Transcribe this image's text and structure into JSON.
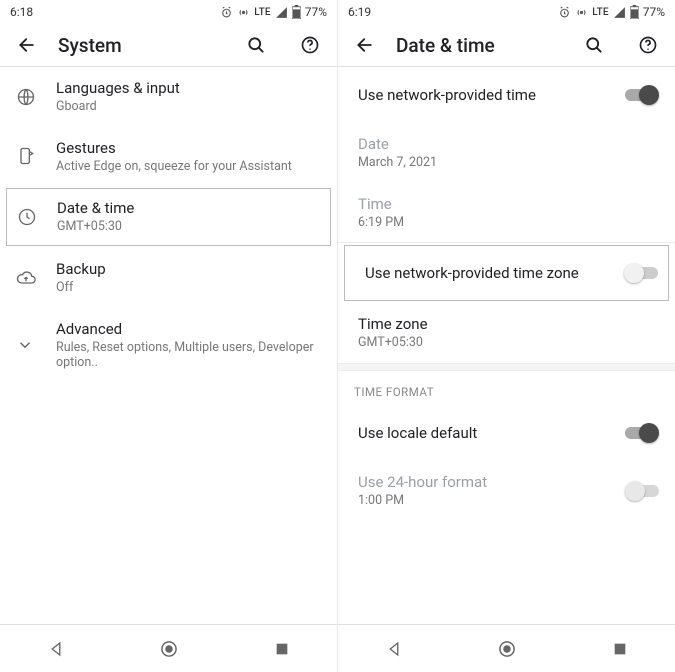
{
  "left": {
    "status": {
      "time": "6:18",
      "lte": "LTE",
      "battery": "77%"
    },
    "appbar": {
      "title": "System"
    },
    "rows": {
      "languages": {
        "label": "Languages & input",
        "sub": "Gboard"
      },
      "gestures": {
        "label": "Gestures",
        "sub": "Active Edge on, squeeze for your Assistant"
      },
      "datetime": {
        "label": "Date & time",
        "sub": "GMT+05:30"
      },
      "backup": {
        "label": "Backup",
        "sub": "Off"
      },
      "advanced": {
        "label": "Advanced",
        "sub": "Rules, Reset options, Multiple users, Developer option.."
      }
    }
  },
  "right": {
    "status": {
      "time": "6:19",
      "lte": "LTE",
      "battery": "77%"
    },
    "appbar": {
      "title": "Date & time"
    },
    "rows": {
      "net_time": {
        "label": "Use network-provided time"
      },
      "date": {
        "label": "Date",
        "sub": "March 7, 2021"
      },
      "time": {
        "label": "Time",
        "sub": "6:19 PM"
      },
      "net_tz": {
        "label": "Use network-provided time zone"
      },
      "tz": {
        "label": "Time zone",
        "sub": "GMT+05:30"
      },
      "section": "TIME FORMAT",
      "locale": {
        "label": "Use locale default"
      },
      "h24": {
        "label": "Use 24-hour format",
        "sub": "1:00 PM"
      }
    }
  }
}
